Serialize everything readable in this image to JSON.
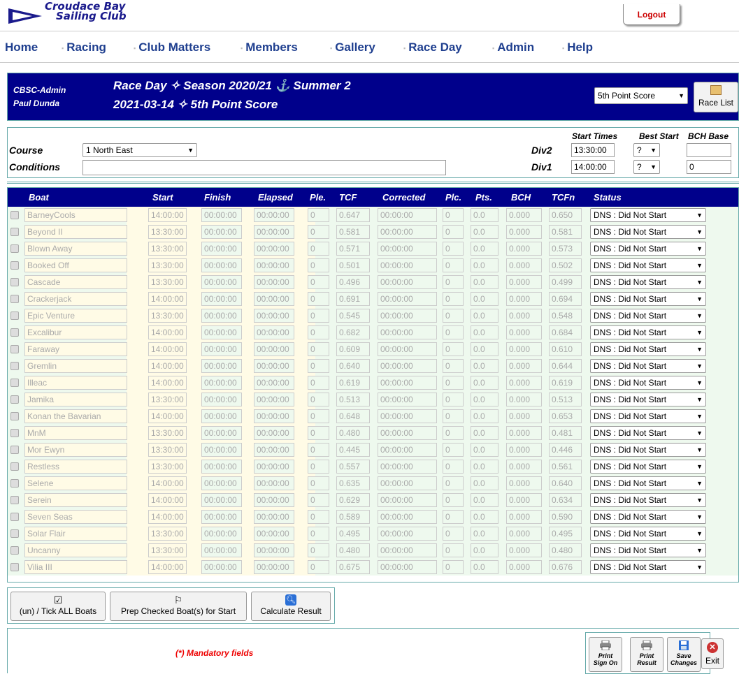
{
  "brand": {
    "line1": "Croudace Bay",
    "line2": "Sailing Club"
  },
  "logout_label": "Logout",
  "nav": [
    "Home",
    "Racing",
    "Club Matters",
    "Members",
    "Gallery",
    "Race Day",
    "Admin",
    "Help"
  ],
  "header": {
    "user_role": "CBSC-Admin",
    "user_name": "Paul Dunda",
    "title_line1": "Race Day ✧ Season 2020/21 ⚓ Summer 2",
    "title_line2": "2021-03-14 ✧ 5th Point Score",
    "race_select": "5th Point Score",
    "race_list_label": "Race List"
  },
  "course": {
    "course_label": "Course",
    "course_value": "1 North East",
    "conditions_label": "Conditions",
    "conditions_value": "",
    "start_times_label": "Start Times",
    "best_start_label": "Best Start",
    "bch_base_label": "BCH Base",
    "div2_label": "Div2",
    "div2_time": "13:30:00",
    "div2_best": "?",
    "div2_bch": "",
    "div1_label": "Div1",
    "div1_time": "14:00:00",
    "div1_best": "?",
    "div1_bch": "0"
  },
  "grid_headers": [
    "Boat",
    "Start",
    "Finish",
    "Elapsed",
    "Ple.",
    "TCF",
    "Corrected",
    "Plc.",
    "Pts.",
    "BCH",
    "TCFn",
    "Status"
  ],
  "boats": [
    {
      "boat": "BarneyCools",
      "start": "14:00:00",
      "finish": "00:00:00",
      "elapsed": "00:00:00",
      "ple": "0",
      "tcf": "0.647",
      "corrected": "00:00:00",
      "plc": "0",
      "pts": "0.0",
      "bch": "0.000",
      "tcfn": "0.650",
      "status": "DNS : Did Not Start"
    },
    {
      "boat": "Beyond II",
      "start": "13:30:00",
      "finish": "00:00:00",
      "elapsed": "00:00:00",
      "ple": "0",
      "tcf": "0.581",
      "corrected": "00:00:00",
      "plc": "0",
      "pts": "0.0",
      "bch": "0.000",
      "tcfn": "0.581",
      "status": "DNS : Did Not Start"
    },
    {
      "boat": "Blown Away",
      "start": "13:30:00",
      "finish": "00:00:00",
      "elapsed": "00:00:00",
      "ple": "0",
      "tcf": "0.571",
      "corrected": "00:00:00",
      "plc": "0",
      "pts": "0.0",
      "bch": "0.000",
      "tcfn": "0.573",
      "status": "DNS : Did Not Start"
    },
    {
      "boat": "Booked Off",
      "start": "13:30:00",
      "finish": "00:00:00",
      "elapsed": "00:00:00",
      "ple": "0",
      "tcf": "0.501",
      "corrected": "00:00:00",
      "plc": "0",
      "pts": "0.0",
      "bch": "0.000",
      "tcfn": "0.502",
      "status": "DNS : Did Not Start"
    },
    {
      "boat": "Cascade",
      "start": "13:30:00",
      "finish": "00:00:00",
      "elapsed": "00:00:00",
      "ple": "0",
      "tcf": "0.496",
      "corrected": "00:00:00",
      "plc": "0",
      "pts": "0.0",
      "bch": "0.000",
      "tcfn": "0.499",
      "status": "DNS : Did Not Start"
    },
    {
      "boat": "Crackerjack",
      "start": "14:00:00",
      "finish": "00:00:00",
      "elapsed": "00:00:00",
      "ple": "0",
      "tcf": "0.691",
      "corrected": "00:00:00",
      "plc": "0",
      "pts": "0.0",
      "bch": "0.000",
      "tcfn": "0.694",
      "status": "DNS : Did Not Start"
    },
    {
      "boat": "Epic Venture",
      "start": "13:30:00",
      "finish": "00:00:00",
      "elapsed": "00:00:00",
      "ple": "0",
      "tcf": "0.545",
      "corrected": "00:00:00",
      "plc": "0",
      "pts": "0.0",
      "bch": "0.000",
      "tcfn": "0.548",
      "status": "DNS : Did Not Start"
    },
    {
      "boat": "Excalibur",
      "start": "14:00:00",
      "finish": "00:00:00",
      "elapsed": "00:00:00",
      "ple": "0",
      "tcf": "0.682",
      "corrected": "00:00:00",
      "plc": "0",
      "pts": "0.0",
      "bch": "0.000",
      "tcfn": "0.684",
      "status": "DNS : Did Not Start"
    },
    {
      "boat": "Faraway",
      "start": "14:00:00",
      "finish": "00:00:00",
      "elapsed": "00:00:00",
      "ple": "0",
      "tcf": "0.609",
      "corrected": "00:00:00",
      "plc": "0",
      "pts": "0.0",
      "bch": "0.000",
      "tcfn": "0.610",
      "status": "DNS : Did Not Start"
    },
    {
      "boat": "Gremlin",
      "start": "14:00:00",
      "finish": "00:00:00",
      "elapsed": "00:00:00",
      "ple": "0",
      "tcf": "0.640",
      "corrected": "00:00:00",
      "plc": "0",
      "pts": "0.0",
      "bch": "0.000",
      "tcfn": "0.644",
      "status": "DNS : Did Not Start"
    },
    {
      "boat": "Illeac",
      "start": "14:00:00",
      "finish": "00:00:00",
      "elapsed": "00:00:00",
      "ple": "0",
      "tcf": "0.619",
      "corrected": "00:00:00",
      "plc": "0",
      "pts": "0.0",
      "bch": "0.000",
      "tcfn": "0.619",
      "status": "DNS : Did Not Start"
    },
    {
      "boat": "Jamika",
      "start": "13:30:00",
      "finish": "00:00:00",
      "elapsed": "00:00:00",
      "ple": "0",
      "tcf": "0.513",
      "corrected": "00:00:00",
      "plc": "0",
      "pts": "0.0",
      "bch": "0.000",
      "tcfn": "0.513",
      "status": "DNS : Did Not Start"
    },
    {
      "boat": "Konan the Bavarian",
      "start": "14:00:00",
      "finish": "00:00:00",
      "elapsed": "00:00:00",
      "ple": "0",
      "tcf": "0.648",
      "corrected": "00:00:00",
      "plc": "0",
      "pts": "0.0",
      "bch": "0.000",
      "tcfn": "0.653",
      "status": "DNS : Did Not Start"
    },
    {
      "boat": "MnM",
      "start": "13:30:00",
      "finish": "00:00:00",
      "elapsed": "00:00:00",
      "ple": "0",
      "tcf": "0.480",
      "corrected": "00:00:00",
      "plc": "0",
      "pts": "0.0",
      "bch": "0.000",
      "tcfn": "0.481",
      "status": "DNS : Did Not Start"
    },
    {
      "boat": "Mor Ewyn",
      "start": "13:30:00",
      "finish": "00:00:00",
      "elapsed": "00:00:00",
      "ple": "0",
      "tcf": "0.445",
      "corrected": "00:00:00",
      "plc": "0",
      "pts": "0.0",
      "bch": "0.000",
      "tcfn": "0.446",
      "status": "DNS : Did Not Start"
    },
    {
      "boat": "Restless",
      "start": "13:30:00",
      "finish": "00:00:00",
      "elapsed": "00:00:00",
      "ple": "0",
      "tcf": "0.557",
      "corrected": "00:00:00",
      "plc": "0",
      "pts": "0.0",
      "bch": "0.000",
      "tcfn": "0.561",
      "status": "DNS : Did Not Start"
    },
    {
      "boat": "Selene",
      "start": "14:00:00",
      "finish": "00:00:00",
      "elapsed": "00:00:00",
      "ple": "0",
      "tcf": "0.635",
      "corrected": "00:00:00",
      "plc": "0",
      "pts": "0.0",
      "bch": "0.000",
      "tcfn": "0.640",
      "status": "DNS : Did Not Start"
    },
    {
      "boat": "Serein",
      "start": "14:00:00",
      "finish": "00:00:00",
      "elapsed": "00:00:00",
      "ple": "0",
      "tcf": "0.629",
      "corrected": "00:00:00",
      "plc": "0",
      "pts": "0.0",
      "bch": "0.000",
      "tcfn": "0.634",
      "status": "DNS : Did Not Start"
    },
    {
      "boat": "Seven Seas",
      "start": "14:00:00",
      "finish": "00:00:00",
      "elapsed": "00:00:00",
      "ple": "0",
      "tcf": "0.589",
      "corrected": "00:00:00",
      "plc": "0",
      "pts": "0.0",
      "bch": "0.000",
      "tcfn": "0.590",
      "status": "DNS : Did Not Start"
    },
    {
      "boat": "Solar Flair",
      "start": "13:30:00",
      "finish": "00:00:00",
      "elapsed": "00:00:00",
      "ple": "0",
      "tcf": "0.495",
      "corrected": "00:00:00",
      "plc": "0",
      "pts": "0.0",
      "bch": "0.000",
      "tcfn": "0.495",
      "status": "DNS : Did Not Start"
    },
    {
      "boat": "Uncanny",
      "start": "13:30:00",
      "finish": "00:00:00",
      "elapsed": "00:00:00",
      "ple": "0",
      "tcf": "0.480",
      "corrected": "00:00:00",
      "plc": "0",
      "pts": "0.0",
      "bch": "0.000",
      "tcfn": "0.480",
      "status": "DNS : Did Not Start"
    },
    {
      "boat": "Vilia III",
      "start": "14:00:00",
      "finish": "00:00:00",
      "elapsed": "00:00:00",
      "ple": "0",
      "tcf": "0.675",
      "corrected": "00:00:00",
      "plc": "0",
      "pts": "0.0",
      "bch": "0.000",
      "tcfn": "0.676",
      "status": "DNS : Did Not Start"
    }
  ],
  "actions": {
    "tick_all": "(un) / Tick ALL Boats",
    "prep": "Prep Checked Boat(s) for Start",
    "calculate": "Calculate Result"
  },
  "footer": {
    "mandatory": "(*) Mandatory fields",
    "print_sign_on_1": "Print",
    "print_sign_on_2": "Sign On",
    "print_result_1": "Print",
    "print_result_2": "Result",
    "save_1": "Save",
    "save_2": "Changes",
    "exit": "Exit"
  },
  "colors": {
    "header_blue": "#00008b",
    "nav_blue": "#1f3f8f",
    "row_green": "#eef9ee",
    "row_yellow": "#fffbe6",
    "accent_red": "#e00000"
  }
}
